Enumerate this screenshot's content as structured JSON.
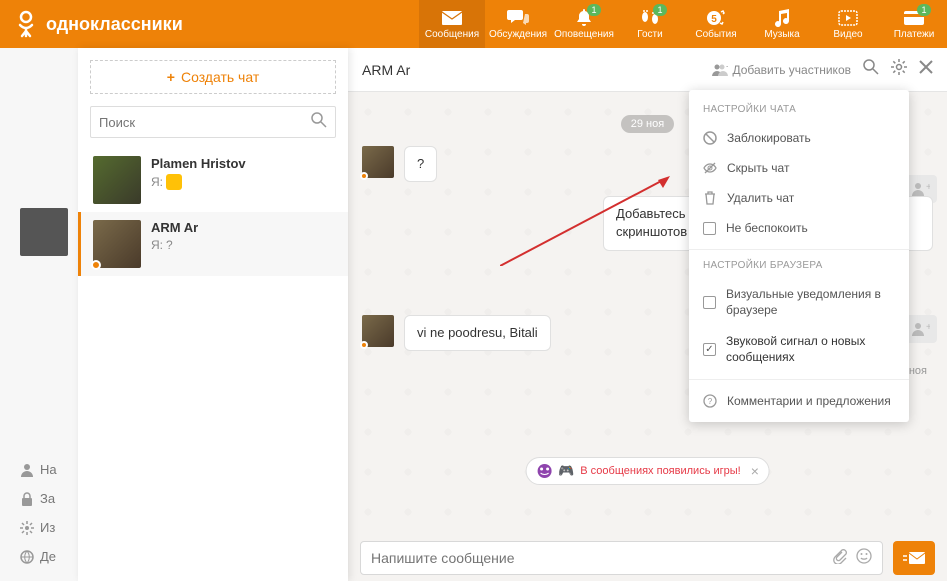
{
  "logo": {
    "text": "одноклассники"
  },
  "nav": [
    {
      "label": "Сообщения",
      "badge": null
    },
    {
      "label": "Обсуждения",
      "badge": null
    },
    {
      "label": "Оповещения",
      "badge": "1"
    },
    {
      "label": "Гости",
      "badge": "1"
    },
    {
      "label": "События",
      "badge": null
    },
    {
      "label": "Музыка",
      "badge": null
    },
    {
      "label": "Видео",
      "badge": null
    },
    {
      "label": "Платежи",
      "badge": "1"
    }
  ],
  "sidebar": {
    "createChat": "Создать чат",
    "searchPlaceholder": "Поиск",
    "conversations": [
      {
        "name": "Plamen Hristov",
        "prefix": "Я:",
        "last": ""
      },
      {
        "name": "ARM Ar",
        "prefix": "Я:",
        "last": "?"
      }
    ]
  },
  "leftNav": [
    {
      "label": "На"
    },
    {
      "label": "За"
    },
    {
      "label": "Из"
    },
    {
      "label": "Де"
    }
  ],
  "chat": {
    "title": "ARM Ar",
    "addMembers": "Добавить участников",
    "date": "29 ноя",
    "messages": [
      {
        "side": "left",
        "text": "?"
      },
      {
        "side": "right",
        "text": "Добавьтесь я потом вас удалю. Мне надо пару скриншотов для инструкции сделать."
      },
      {
        "side": "left",
        "text": "vi ne poodresu, Bitali"
      }
    ],
    "readStatus": "Прочитано 29 ноя",
    "gamesChip": "В сообщениях появились игры!",
    "inputPlaceholder": "Напишите сообщение"
  },
  "dropdown": {
    "chatSettingsTitle": "НАСТРОЙКИ ЧАТА",
    "items": [
      {
        "label": "Заблокировать"
      },
      {
        "label": "Скрыть чат"
      },
      {
        "label": "Удалить чат"
      },
      {
        "label": "Не беспокоить"
      }
    ],
    "browserSettingsTitle": "НАСТРОЙКИ БРАУЗЕРА",
    "browserItems": [
      {
        "label": "Визуальные уведомления в браузере",
        "checked": false
      },
      {
        "label": "Звуковой сигнал о новых сообщениях",
        "checked": true
      }
    ],
    "feedback": "Комментарии и предложения"
  }
}
